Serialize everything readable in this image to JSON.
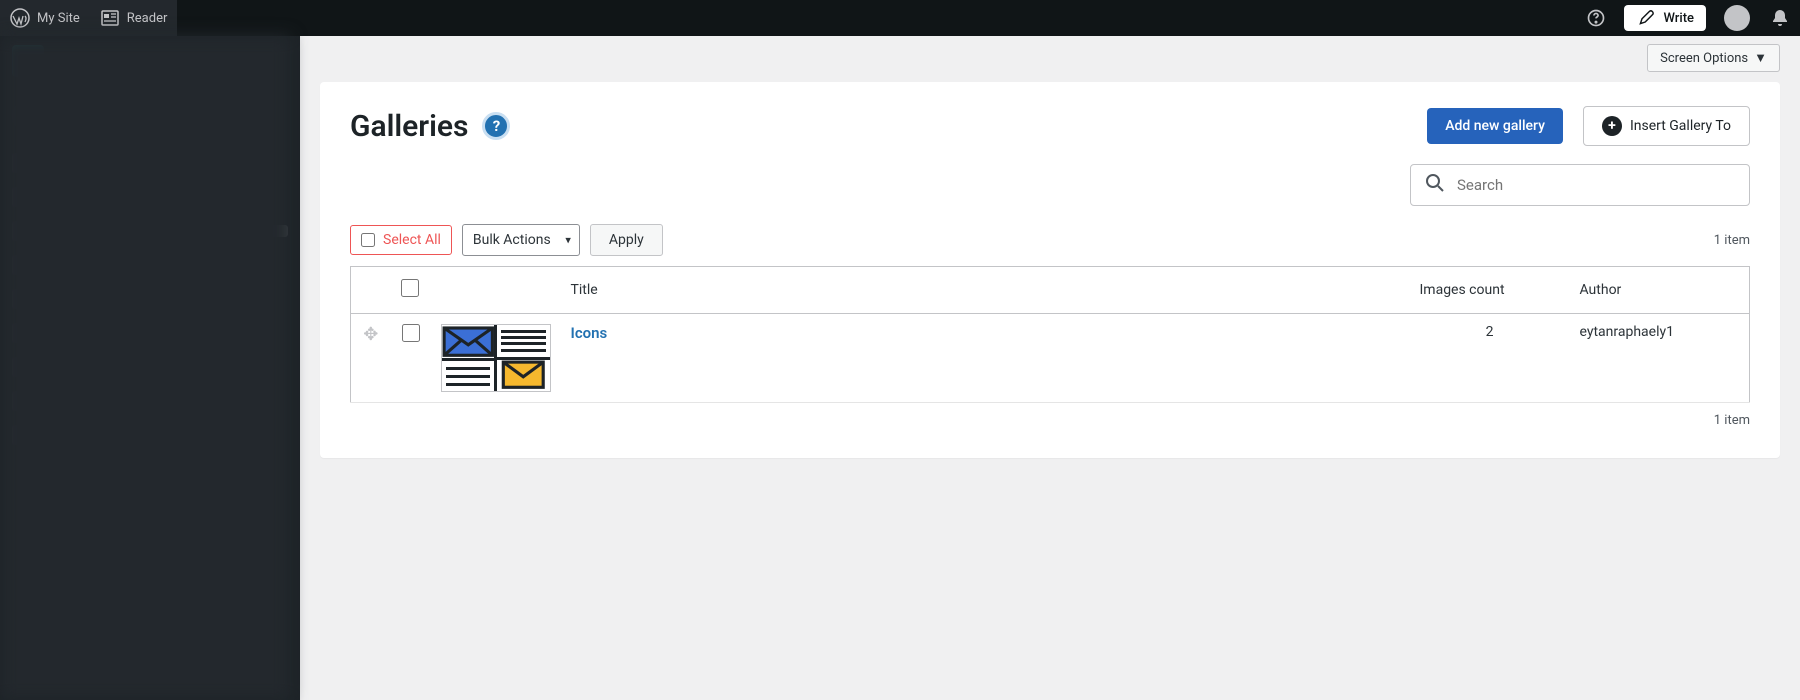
{
  "toolbar": {
    "my_site": "My Site",
    "reader": "Reader",
    "write": "Write"
  },
  "screen_options": "Screen Options",
  "panel": {
    "title": "Galleries",
    "help": "?",
    "add_new": "Add new gallery",
    "insert_to": "Insert Gallery To"
  },
  "search": {
    "placeholder": "Search"
  },
  "controls": {
    "select_all": "Select All",
    "bulk_actions": "Bulk Actions",
    "apply": "Apply"
  },
  "count_top": "1 item",
  "count_bottom": "1 item",
  "table": {
    "headers": {
      "title": "Title",
      "images_count": "Images count",
      "author": "Author"
    },
    "rows": [
      {
        "title": "Icons",
        "images_count": "2",
        "author": "eytanraphaely1"
      }
    ]
  }
}
